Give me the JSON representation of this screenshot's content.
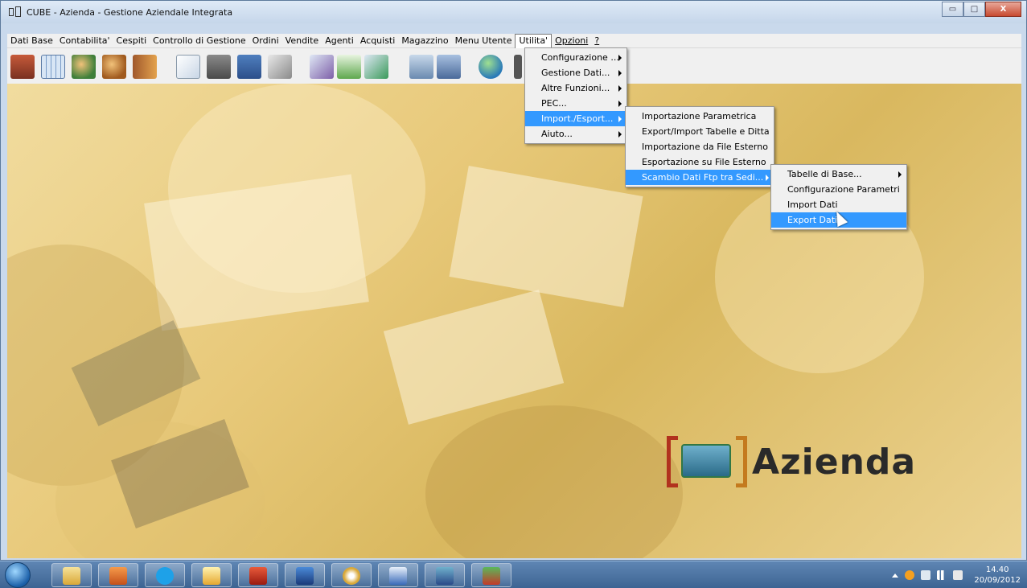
{
  "window": {
    "title": "CUBE - Azienda  -  Gestione Aziendale Integrata",
    "minimize_glyph": "▭",
    "maximize_glyph": "□",
    "close_glyph": "X"
  },
  "menubar": {
    "items": [
      "Dati Base",
      "Contabilita'",
      "Cespiti",
      "Controllo di Gestione",
      "Ordini",
      "Vendite",
      "Agenti",
      "Acquisti",
      "Magazzino",
      "Menu Utente",
      "Utilita'",
      "Opzioni",
      "?"
    ],
    "active": "Utilita'"
  },
  "utilita_menu": [
    "Configurazione ...",
    "Gestione Dati...",
    "Altre Funzioni...",
    "PEC...",
    "Import./Esport...",
    "Aiuto..."
  ],
  "import_export_menu": [
    "Importazione Parametrica",
    "Export/Import Tabelle e Ditta",
    "Importazione da File Esterno",
    "Esportazione su File Esterno",
    "Scambio Dati Ftp tra Sedi..."
  ],
  "scambio_menu": [
    "Tabelle di Base...",
    "Configurazione Parametri",
    "Import Dati",
    "Export Dati"
  ],
  "brand": {
    "name": "Azienda"
  },
  "taskbar": {
    "time": "14.40",
    "date": "20/09/2012"
  },
  "colors": {
    "menu_highlight": "#3399ff",
    "brand_red": "#b1321e",
    "brand_orange": "#c47a1e"
  }
}
